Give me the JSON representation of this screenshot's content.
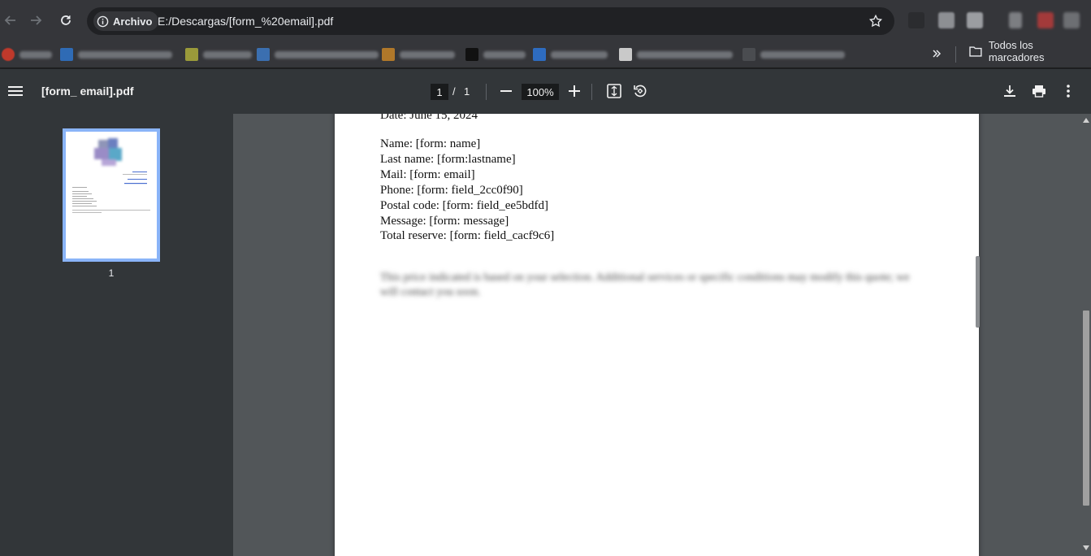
{
  "browser": {
    "secure_chip_label": "Archivo",
    "url": "E:/Descargas/[form_%20email].pdf",
    "all_bookmarks_label": "Todos los marcadores",
    "colors": {
      "toolbar": "#35363a",
      "omnibox": "#202124",
      "accent": "#8ab4f8"
    }
  },
  "pdf_toolbar": {
    "title": "[form_ email].pdf",
    "current_page": "1",
    "page_separator": "/",
    "total_pages": "1",
    "zoom": "100%"
  },
  "sidebar": {
    "thumbnails": [
      {
        "label": "1"
      }
    ]
  },
  "document": {
    "date_line": "Date: June 15, 2024",
    "fields": [
      "Name: [form: name]",
      "Last name: [form:lastname]",
      "Mail: [form: email]",
      "Phone: [form: field_2cc0f90]",
      "Postal code: [form: field_ee5bdfd]",
      "Message: [form: message]",
      "Total reserve: [form: field_cacf9c6]"
    ],
    "blurred_paragraph": "This price indicated is based on your selection. Additional services or specific conditions may modify this quote; we will contact you soon."
  }
}
